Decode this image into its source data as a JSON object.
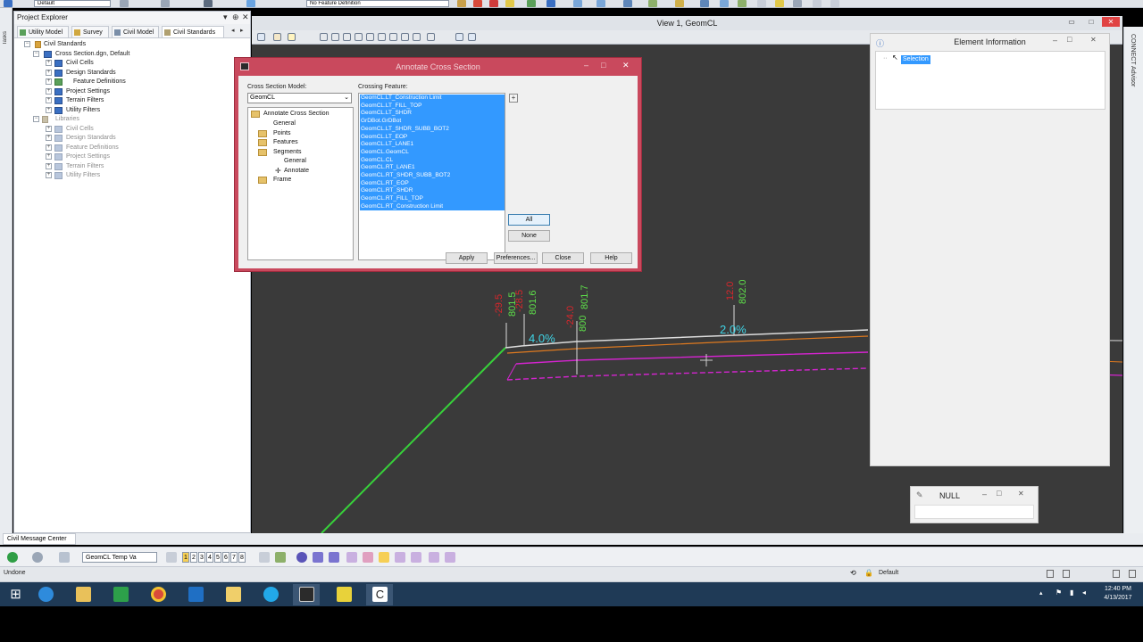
{
  "topbar": {
    "level_combo": "Default",
    "feature_combo": "No Feature Definition"
  },
  "taskstrip": {
    "label": "Tasks"
  },
  "explorer": {
    "title": "Project Explorer",
    "tabs": [
      "Utility Model",
      "Survey",
      "Civil Model",
      "Civil Standards"
    ],
    "tree": [
      {
        "label": "Civil Standards",
        "dim": false
      },
      {
        "label": "Cross Section.dgn, Default",
        "dim": false
      },
      {
        "label": "Civil Cells",
        "dim": false
      },
      {
        "label": "Design Standards",
        "dim": false
      },
      {
        "label": "Feature Definitions",
        "dim": false
      },
      {
        "label": "Project Settings",
        "dim": false
      },
      {
        "label": "Terrain Filters",
        "dim": false
      },
      {
        "label": "Utility Filters",
        "dim": false
      },
      {
        "label": "Libraries",
        "dim": true
      },
      {
        "label": "Civil Cells",
        "dim": true
      },
      {
        "label": "Design Standards",
        "dim": true
      },
      {
        "label": "Feature Definitions",
        "dim": true
      },
      {
        "label": "Project Settings",
        "dim": true
      },
      {
        "label": "Terrain Filters",
        "dim": true
      },
      {
        "label": "Utility Filters",
        "dim": true
      }
    ]
  },
  "view": {
    "title": "View 1, GeomCL",
    "right_strip_label": "CONNECT Advisor",
    "annotations": {
      "slope_left": "4.0%",
      "slope_right": "2.0%",
      "elev_801_5": "801.5",
      "elev_801_6": "801.6",
      "elev_801_7": "801.7",
      "elev_800": "800",
      "elev_802_0": "802.0",
      "off_neg_29": "-29.5",
      "off_neg_28": "-28.5",
      "off_neg_24": "-24.0",
      "off_12": "12.0"
    }
  },
  "element_info": {
    "title": "Element Information",
    "node": "Selection"
  },
  "null_window": {
    "title": "NULL"
  },
  "dialog": {
    "title": "Annotate Cross Section",
    "model_label": "Cross Section Model:",
    "model_value": "GeomCL",
    "feature_label": "Crossing Feature:",
    "nav": [
      "Annotate Cross Section",
      "General",
      "Points",
      "Features",
      "Segments",
      "General",
      "Annotate",
      "Frame"
    ],
    "features": [
      "GeomCL.LT_Construction Limit",
      "GeomCL.LT_FILL_TOP",
      "GeomCL.LT_SHDR",
      "GrDBot.GrDBot",
      "GeomCL.LT_SHDR_SUBB_BOT2",
      "GeomCL.LT_EOP",
      "GeomCL.LT_LANE1",
      "GeomCL.GeomCL",
      "GeomCL.CL",
      "GeomCL.RT_LANE1",
      "GeomCL.RT_SHDR_SUBB_BOT2",
      "GeomCL.RT_EOP",
      "GeomCL.RT_SHDR",
      "GeomCL.RT_FILL_TOP",
      "GeomCL.RT_Construction Limit"
    ],
    "btn_all": "All",
    "btn_none": "None",
    "btn_apply": "Apply",
    "btn_prefs": "Preferences...",
    "btn_close": "Close",
    "btn_help": "Help"
  },
  "message_center": {
    "tab": "Civil Message Center"
  },
  "bottom": {
    "template_combo": "GeomCL Temp Va",
    "views": [
      "1",
      "2",
      "3",
      "4",
      "5",
      "6",
      "7",
      "8"
    ],
    "status": "Undone",
    "level": "Default"
  },
  "clock": {
    "time": "12:40 PM",
    "date": "4/13/2017"
  },
  "colors": {
    "dialog_frame": "#c9495d",
    "selection": "#3399ff",
    "canvas": "#3a3a3a",
    "annot_green": "#5ee04a",
    "annot_red": "#d8262b",
    "annot_cyan": "#3fd4e6",
    "magenta": "#d524d0",
    "orange": "#e07a1f"
  }
}
